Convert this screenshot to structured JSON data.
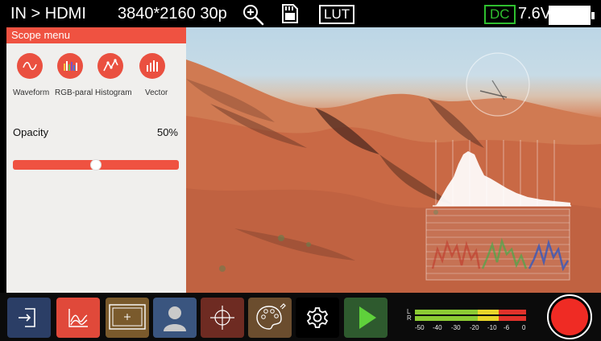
{
  "topbar": {
    "input": "IN > HDMI",
    "resolution": "3840*2160 30p",
    "lut": "LUT",
    "power_source": "DC",
    "voltage": "7.6V",
    "battery_level": 1.0
  },
  "scope_menu": {
    "title": "Scope menu",
    "scopes": [
      {
        "label": "Waveform",
        "icon": "waveform-icon"
      },
      {
        "label": "RGB-paral",
        "icon": "rgb-parade-icon"
      },
      {
        "label": "Histogram",
        "icon": "histogram-icon"
      },
      {
        "label": "Vector",
        "icon": "vector-icon"
      }
    ],
    "opacity_label": "Opacity",
    "opacity_value": "50%",
    "opacity_fraction": 0.5
  },
  "toolbar": {
    "items": [
      {
        "name": "input-button",
        "icon": "enter-icon",
        "color": "#2b3e66"
      },
      {
        "name": "scope-button",
        "icon": "waveform-icon",
        "color": "#e0493a"
      },
      {
        "name": "frame-guide-button",
        "icon": "frame-guide-icon",
        "color": "#7a5a2c"
      },
      {
        "name": "user-profile-button",
        "icon": "person-icon",
        "color": "#3a557f"
      },
      {
        "name": "center-marker-button",
        "icon": "crosshair-icon",
        "color": "#6e2b22"
      },
      {
        "name": "color-palette-button",
        "icon": "palette-icon",
        "color": "#6b4d2e"
      },
      {
        "name": "settings-button",
        "icon": "gear-icon",
        "color": "#000000"
      },
      {
        "name": "playback-button",
        "icon": "play-icon",
        "color": "#2e5a2e"
      }
    ]
  },
  "audio_meter": {
    "channels": [
      "L",
      "R"
    ],
    "scale": [
      "-50",
      "-40",
      "-30",
      "-20",
      "-10",
      "-6",
      "0"
    ],
    "colors": {
      "green": "#8ccb34",
      "yellow": "#e8d52a",
      "red": "#e0322b"
    }
  },
  "record": {
    "color": "#ef2b24"
  }
}
